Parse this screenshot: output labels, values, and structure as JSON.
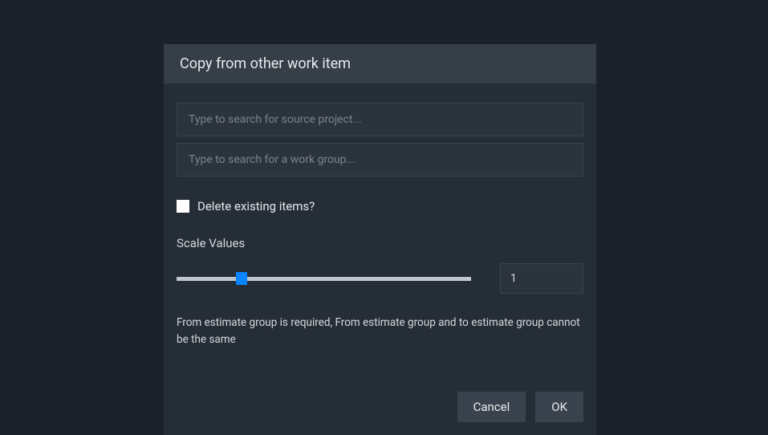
{
  "dialog": {
    "title": "Copy from other work item",
    "project_search_placeholder": "Type to search for source project...",
    "project_search_value": "",
    "workgroup_search_placeholder": "Type to search for a work group...",
    "workgroup_search_value": "",
    "delete_checkbox_label": "Delete existing items?",
    "delete_checked": false,
    "scale_label": "Scale Values",
    "scale_value": "1",
    "slider_position_percent": 22,
    "error_message": "From estimate group is required, From estimate group and to estimate group cannot be the same",
    "cancel_label": "Cancel",
    "ok_label": "OK"
  },
  "colors": {
    "page_bg": "#1a2129",
    "dialog_bg": "#252d36",
    "header_bg": "#363e47",
    "input_bg": "#2b333c",
    "button_bg": "#3a434d",
    "slider_thumb": "#0a84ff"
  }
}
